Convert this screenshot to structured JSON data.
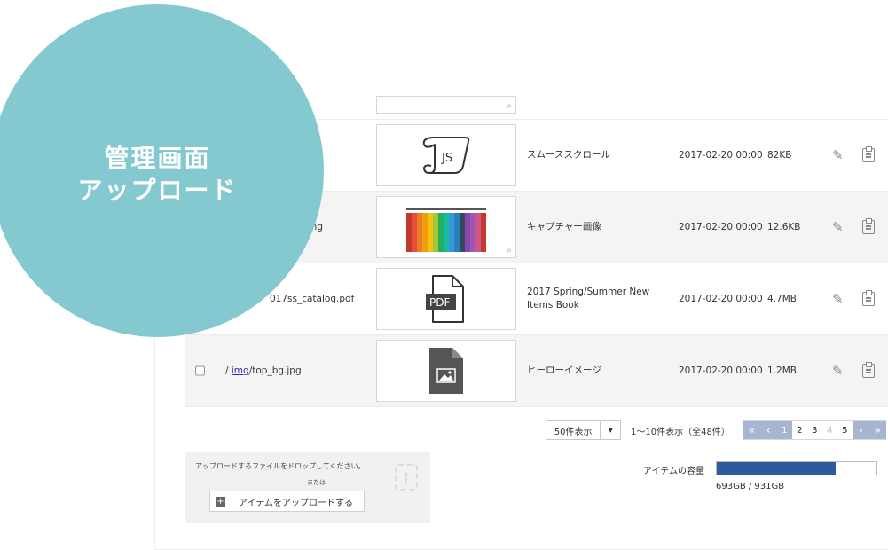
{
  "overlay": {
    "line1": "管理画面",
    "line2": "アップロード"
  },
  "files": [
    {
      "path_prefix": "",
      "path_link": "",
      "path_rest": "",
      "title": "",
      "date": "",
      "size": "",
      "kind": "partial"
    },
    {
      "path_prefix": "",
      "path_link": "",
      "path_rest": "",
      "title": "スムーススクロール",
      "date": "2017-02-20 00:00",
      "size": "82KB",
      "kind": "js",
      "thumb_label": "JS"
    },
    {
      "path_prefix": "",
      "path_link": "",
      "path_rest": "png",
      "title": "キャプチャー画像",
      "date": "2017-02-20 00:00",
      "size": "12.6KB",
      "kind": "photo"
    },
    {
      "path_prefix": "",
      "path_link": "",
      "path_rest": "017ss_catalog.pdf",
      "title": "2017 Spring/Summer New Items Book",
      "date": "2017-02-20 00:00",
      "size": "4.7MB",
      "kind": "pdf",
      "thumb_label": "PDF"
    },
    {
      "path_prefix": "/ ",
      "path_link": "img",
      "path_rest": "/top_bg.jpg",
      "title": "ヒーローイメージ",
      "date": "2017-02-20 00:00",
      "size": "1.2MB",
      "kind": "image"
    }
  ],
  "pager": {
    "per_page": "50件表示",
    "range": "1〜10件表示（全48件）",
    "first": "«",
    "prev": "‹",
    "next": "›",
    "last": "»",
    "pages": [
      "1",
      "2",
      "3",
      "4",
      "5"
    ],
    "current": "1",
    "disabled": [
      "4"
    ]
  },
  "upload": {
    "drop_text": "アップロードするファイルをドロップしてください。",
    "or_text": "または",
    "button_label": "アイテムをアップロードする",
    "plus": "+",
    "upload_glyph": "↑"
  },
  "capacity": {
    "label": "アイテムの容量",
    "used": "693GB",
    "total": "931GB",
    "text": "693GB / 931GB",
    "fraction": 0.744
  },
  "colors": {
    "circle": "#85c9d0",
    "accent": "#2c5a9c",
    "pager": "#a7b6ce"
  },
  "icons": {
    "edit": "pencil-icon",
    "clipboard": "clipboard-icon",
    "zoom": "magnifier-icon"
  }
}
